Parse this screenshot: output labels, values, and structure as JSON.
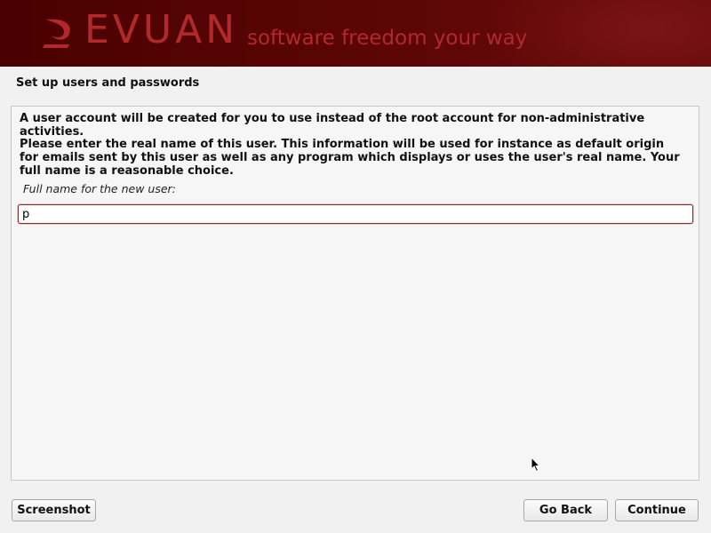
{
  "banner": {
    "logo_text": "EVUAN",
    "tagline": "software freedom your way"
  },
  "page": {
    "title": "Set up users and passwords"
  },
  "content": {
    "paragraph1": "A user account will be created for you to use instead of the root account for non-administrative activities.",
    "paragraph2": "Please enter the real name of this user. This information will be used for instance as default origin for emails sent by this user as well as any program which displays or uses the user's real name. Your full name is a reasonable choice.",
    "field_label": "Full name for the new user:",
    "field_value": "p"
  },
  "buttons": {
    "screenshot": "Screenshot",
    "go_back": "Go Back",
    "continue": "Continue"
  },
  "colors": {
    "banner_bg": "#4a0000",
    "brand_red": "#b2292b",
    "input_border": "#8a2a2a"
  },
  "icons": {
    "logo": "devuan-logo-icon",
    "pointer": "mouse-pointer-icon"
  }
}
